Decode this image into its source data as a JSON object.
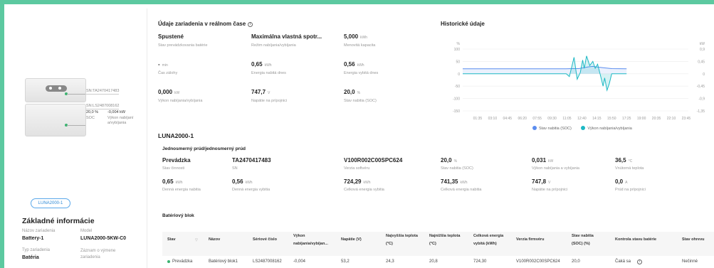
{
  "device_panel": {
    "callout_top": "SN:TA2470417483",
    "callout_bot_sn": "SN:LS2487008162",
    "callout_bot_soc_value": "20,0 %",
    "callout_bot_soc_label": "SOC",
    "callout_bot_power_value": "-0,004 kW",
    "callout_bot_power_label": "Výkon nabíjaní a/vybíjania",
    "chip": "LUNA2000-1",
    "title": "Základné informácie",
    "fields": [
      {
        "label": "Názov zariadenia",
        "value": "Battery-1"
      },
      {
        "label": "Model",
        "value": "LUNA2000-5KW-C0"
      },
      {
        "label": "Typ zariadenia",
        "value": "Batéria"
      },
      {
        "label": "Záznam o výmene zariadenia",
        "value": ""
      }
    ]
  },
  "realtime": {
    "title": "Údaje zariadenia v reálnom čase",
    "info_icon": "info-circle-icon",
    "metrics": [
      {
        "value": "Spustené",
        "unit": "",
        "label": "Stav prevádzkovania batérie"
      },
      {
        "value": "Maximálna vlastná spotr...",
        "unit": "",
        "label": "Režim nabíjania/vybíjania"
      },
      {
        "value": "5,000",
        "unit": "kWh",
        "label": "Menovitá kapacita"
      },
      {
        "value": "-",
        "unit": "min",
        "label": "Čas zálohy"
      },
      {
        "value": "0,65",
        "unit": "kWh",
        "label": "Energia nabitá dnes"
      },
      {
        "value": "0,56",
        "unit": "kWh",
        "label": "Energia vybitá dnes"
      },
      {
        "value": "0,000",
        "unit": "kW",
        "label": "Výkon nabíjania/vybíjania"
      },
      {
        "value": "747,7",
        "unit": "V",
        "label": "Napätie na prípojnici"
      },
      {
        "value": "20,0",
        "unit": "%",
        "label": "Stav nabitia (SOC)"
      }
    ]
  },
  "history": {
    "title": "Historické údaje",
    "left_unit": "%",
    "right_unit": "kW",
    "left_ticks": [
      "100",
      "50",
      "0",
      "-50",
      "-100",
      "-150"
    ],
    "right_ticks": [
      "0,9",
      "0,45",
      "0",
      "-0,45",
      "-0,9",
      "-1,35"
    ]
  },
  "chart_data": {
    "type": "line",
    "title": "Historické údaje",
    "x": [
      "01:35",
      "03:10",
      "04:45",
      "06:20",
      "07:55",
      "09:30",
      "11:05",
      "12:40",
      "14:15",
      "15:50",
      "17:25",
      "19:00",
      "20:35",
      "22:10",
      "23:45"
    ],
    "ylim_left": [
      -150,
      100
    ],
    "ylim_right": [
      -1.35,
      0.9
    ],
    "grid": true,
    "legend_placement": "bottom",
    "series": [
      {
        "name": "Stav nabitia (SOC)",
        "color": "#5b8def",
        "axis": "left",
        "points": [
          [
            "00:00",
            20
          ],
          [
            "11:00",
            20
          ],
          [
            "11:40",
            21
          ],
          [
            "12:20",
            21
          ],
          [
            "12:50",
            24
          ],
          [
            "13:20",
            28
          ],
          [
            "13:50",
            30
          ],
          [
            "14:20",
            27
          ],
          [
            "15:00",
            24
          ],
          [
            "15:50",
            21
          ],
          [
            "17:25",
            20
          ]
        ]
      },
      {
        "name": "Výkon nabíjania/vybíjania",
        "color": "#1cb8c4",
        "axis": "right",
        "points": [
          [
            "00:00",
            0
          ],
          [
            "11:00",
            0
          ],
          [
            "11:20",
            -0.1
          ],
          [
            "11:50",
            0.6
          ],
          [
            "12:10",
            -0.2
          ],
          [
            "12:30",
            0.05
          ],
          [
            "12:45",
            0.5
          ],
          [
            "12:55",
            0.2
          ],
          [
            "13:10",
            0.65
          ],
          [
            "13:30",
            0.3
          ],
          [
            "13:50",
            0.45
          ],
          [
            "14:05",
            0.2
          ],
          [
            "14:20",
            0.35
          ],
          [
            "14:40",
            -0.1
          ],
          [
            "14:55",
            -0.45
          ],
          [
            "15:05",
            -0.15
          ],
          [
            "15:20",
            -0.6
          ],
          [
            "15:35",
            -0.35
          ],
          [
            "15:50",
            0.0
          ],
          [
            "17:25",
            0.0
          ]
        ]
      }
    ]
  },
  "luna": {
    "title": "LUNA2000-1",
    "subtitle": "Jednosmerný prúd/jednosmerný prúd",
    "metrics": [
      {
        "value": "Prevádzka",
        "unit": "",
        "label": "Stav činnosti"
      },
      {
        "value": "TA2470417483",
        "unit": "",
        "label": "SN"
      },
      {
        "value": "V100R002C00SPC624",
        "unit": "",
        "label": "Verzia softvéru"
      },
      {
        "value": "20,0",
        "unit": "%",
        "label": "Stav nabitia (SOC)"
      },
      {
        "value": "0,031",
        "unit": "kW",
        "label": "Výkon nabíjania a vybíjania"
      },
      {
        "value": "36,5",
        "unit": "°C",
        "label": "Vnútorná teplota"
      },
      {
        "value": "0,65",
        "unit": "kWh",
        "label": "Denná energia nabitia"
      },
      {
        "value": "0,56",
        "unit": "kWh",
        "label": "Denná energia vybitia"
      },
      {
        "value": "724,29",
        "unit": "kWh",
        "label": "Celková energia vybitia"
      },
      {
        "value": "741,35",
        "unit": "kWh",
        "label": "Celková energia nabitia"
      },
      {
        "value": "747,8",
        "unit": "V",
        "label": "Napätie na prípojnici"
      },
      {
        "value": "0,0",
        "unit": "A",
        "label": "Prúd na prípojnici"
      }
    ]
  },
  "battery_block": {
    "title": "Batériový blok",
    "columns": [
      {
        "l1": "Stav",
        "l2": ""
      },
      {
        "l1": "Názov",
        "l2": ""
      },
      {
        "l1": "Sériové číslo",
        "l2": ""
      },
      {
        "l1": "Výkon",
        "l2": "nabíjania/vybíjan..."
      },
      {
        "l1": "Napätie (V)",
        "l2": ""
      },
      {
        "l1": "Najvyššia teplota",
        "l2": "(°C)"
      },
      {
        "l1": "Najnižšia teplota",
        "l2": "(°C)"
      },
      {
        "l1": "Celková energia",
        "l2": "vybitá (kWh)"
      },
      {
        "l1": "Verzia firmvéru",
        "l2": ""
      },
      {
        "l1": "Stav nabitia",
        "l2": "(SOC) (%)"
      },
      {
        "l1": "Kontrola stavu batérie",
        "l2": ""
      },
      {
        "l1": "Stav ohrevu",
        "l2": ""
      }
    ],
    "rows": [
      [
        "Prevádzka",
        "Batériový blok1",
        "LS2487008162",
        "-0,004",
        "53,2",
        "24,3",
        "20,8",
        "724,30",
        "V100R002C00SPC624",
        "20,0",
        "Čaká sa",
        "Nečinné"
      ]
    ]
  }
}
